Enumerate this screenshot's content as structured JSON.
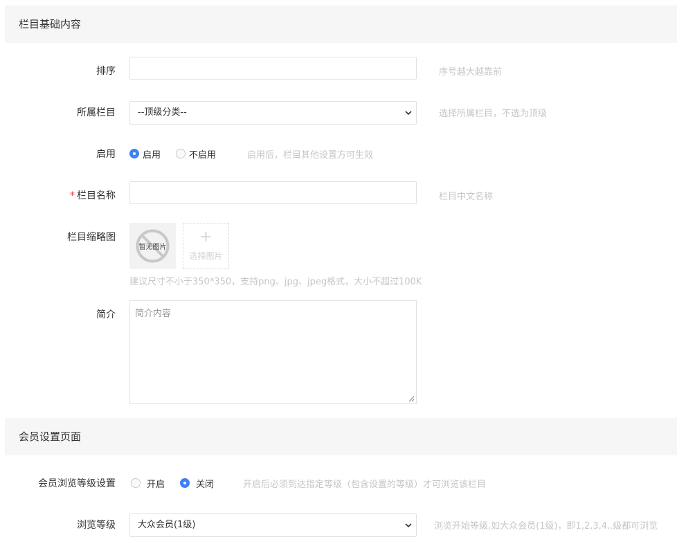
{
  "section1": {
    "title": "栏目基础内容"
  },
  "sort": {
    "label": "排序",
    "value": "",
    "hint": "序号越大越靠前"
  },
  "parent": {
    "label": "所属栏目",
    "selected": "--顶级分类--",
    "hint": "选择所属栏目，不选为顶级"
  },
  "enable": {
    "label": "启用",
    "options": [
      "启用",
      "不启用"
    ],
    "selected": "启用",
    "hint": "启用后，栏目其他设置方可生效"
  },
  "name": {
    "required_mark": "*",
    "label": "栏目名称",
    "value": "",
    "hint": "栏目中文名称"
  },
  "thumbnail": {
    "label": "栏目缩略图",
    "empty_text": "暂无图片",
    "upload_label": "选择图片",
    "upload_plus": "+",
    "hint": "建议尺寸不小于350*350，支持png、jpg、jpeg格式，大小不超过100K"
  },
  "intro": {
    "label": "简介",
    "placeholder": "简介内容"
  },
  "section2": {
    "title": "会员设置页面"
  },
  "member_level_setting": {
    "label": "会员浏览等级设置",
    "options": [
      "开启",
      "关闭"
    ],
    "selected": "关闭",
    "hint": "开启后必须到达指定等级（包含设置的等级）才可浏览该栏目"
  },
  "browse_level": {
    "label": "浏览等级",
    "selected": "大众会员(1级)",
    "hint": "浏览开始等级,如大众会员(1级)，即1,2,3,4..级都可浏览"
  },
  "colors": {
    "accent": "#3c82f6",
    "hint": "#c6c6c6",
    "required": "#e33333",
    "section_bg": "#f6f6f6"
  }
}
